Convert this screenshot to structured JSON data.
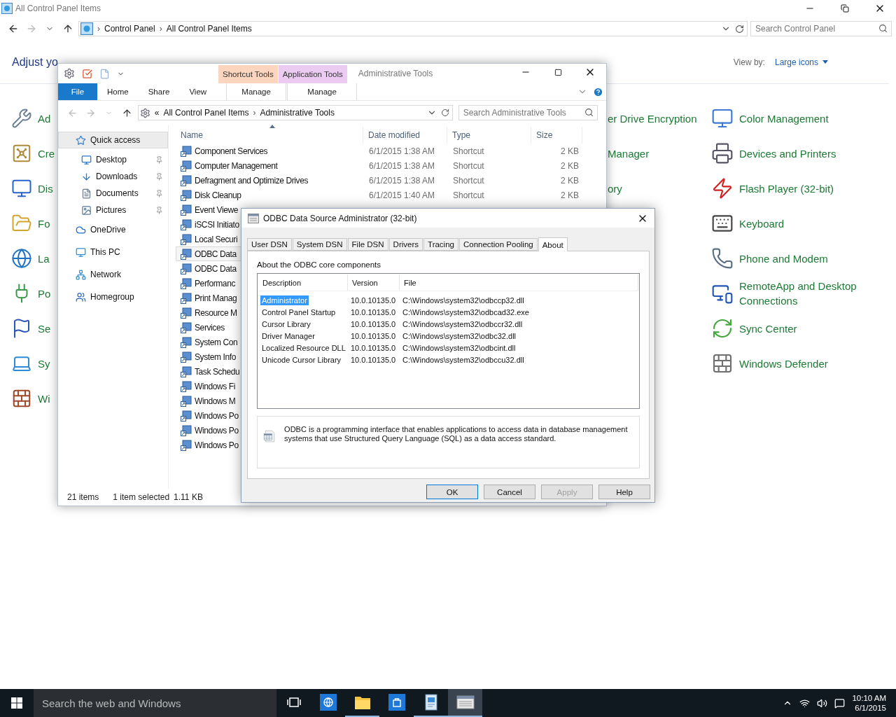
{
  "control_panel": {
    "title": "All Control Panel Items",
    "breadcrumb": [
      "Control Panel",
      "All Control Panel Items"
    ],
    "search": {
      "placeholder": "Search Control Panel"
    },
    "heading": "Adjust yo",
    "view_by_label": "View by:",
    "view_by_value": "Large icons",
    "separator": "›",
    "columns": [
      {
        "items": [
          "Ad",
          "Cre",
          "Dis",
          "Fo",
          "La",
          "Po",
          "Se",
          "Sy",
          "Wi"
        ]
      },
      {
        "items": [
          "er Drive Encryption",
          "Manager",
          "ory"
        ]
      },
      {
        "items": [
          "Color Management",
          "Devices and Printers",
          "Flash Player (32-bit)",
          "Keyboard",
          "Phone and Modem",
          "RemoteApp and Desktop Connections",
          "Sync Center",
          "Windows Defender"
        ]
      }
    ]
  },
  "explorer": {
    "context_tabs": [
      {
        "label": "Shortcut Tools",
        "tab": "Manage",
        "color": "#fbd5bd"
      },
      {
        "label": "Application Tools",
        "tab": "Manage",
        "color": "#eccbf3"
      }
    ],
    "title": "Administrative Tools",
    "ribbon_tabs": [
      {
        "label": "File",
        "kind": "file"
      },
      {
        "label": "Home",
        "kind": "tab"
      },
      {
        "label": "Share",
        "kind": "tab"
      },
      {
        "label": "View",
        "kind": "tab"
      }
    ],
    "address": {
      "overflow_mark": "«",
      "separator": "›",
      "crumbs": [
        "All Control Panel Items",
        "Administrative Tools"
      ]
    },
    "search": {
      "placeholder": "Search Administrative Tools"
    },
    "nav": [
      {
        "label": "Quick access",
        "selected": true,
        "children": [
          {
            "label": "Desktop",
            "pinned": true,
            "selected": false
          },
          {
            "label": "Downloads",
            "pinned": true,
            "selected": false
          },
          {
            "label": "Documents",
            "pinned": true,
            "selected": false
          },
          {
            "label": "Pictures",
            "pinned": true,
            "selected": false
          }
        ]
      },
      {
        "label": "OneDrive",
        "selected": false
      },
      {
        "label": "This PC",
        "selected": false
      },
      {
        "label": "Network",
        "selected": false
      },
      {
        "label": "Homegroup",
        "selected": false
      }
    ],
    "columns": [
      "Name",
      "Date modified",
      "Type",
      "Size"
    ],
    "files": [
      {
        "name": "Component Services",
        "date": "6/1/2015 1:38 AM",
        "type": "Shortcut",
        "size": "2 KB",
        "selected": false
      },
      {
        "name": "Computer Management",
        "date": "6/1/2015 1:38 AM",
        "type": "Shortcut",
        "size": "2 KB",
        "selected": false
      },
      {
        "name": "Defragment and Optimize Drives",
        "date": "6/1/2015 1:38 AM",
        "type": "Shortcut",
        "size": "2 KB",
        "selected": false
      },
      {
        "name": "Disk Cleanup",
        "date": "6/1/2015 1:40 AM",
        "type": "Shortcut",
        "size": "2 KB",
        "selected": false
      },
      {
        "name": "Event Viewe",
        "selected": false
      },
      {
        "name": "iSCSI Initiato",
        "selected": false
      },
      {
        "name": "Local Securi",
        "selected": false
      },
      {
        "name": "ODBC Data",
        "selected": true
      },
      {
        "name": "ODBC Data",
        "selected": false
      },
      {
        "name": "Performanc",
        "selected": false
      },
      {
        "name": "Print Manag",
        "selected": false
      },
      {
        "name": "Resource M",
        "selected": false
      },
      {
        "name": "Services",
        "selected": false
      },
      {
        "name": "System Con",
        "selected": false
      },
      {
        "name": "System Info",
        "selected": false
      },
      {
        "name": "Task Schedu",
        "selected": false
      },
      {
        "name": "Windows Fi",
        "selected": false
      },
      {
        "name": "Windows M",
        "selected": false
      },
      {
        "name": "Windows Po",
        "selected": false
      },
      {
        "name": "Windows Po",
        "selected": false
      },
      {
        "name": "Windows Po",
        "selected": false
      }
    ],
    "status": {
      "count": "21 items",
      "selection": "1 item selected",
      "size": "1.11 KB"
    }
  },
  "dialog": {
    "title": "ODBC Data Source Administrator (32-bit)",
    "tabs": [
      {
        "label": "User DSN",
        "selected": false
      },
      {
        "label": "System DSN",
        "selected": false
      },
      {
        "label": "File DSN",
        "selected": false
      },
      {
        "label": "Drivers",
        "selected": false
      },
      {
        "label": "Tracing",
        "selected": false
      },
      {
        "label": "Connection Pooling",
        "selected": false
      },
      {
        "label": "About",
        "selected": true
      }
    ],
    "section_label": "About the ODBC core components",
    "columns": [
      "Description",
      "Version",
      "File"
    ],
    "rows": [
      {
        "description": "Administrator",
        "version": "10.0.10135.0",
        "file": "C:\\Windows\\system32\\odbccp32.dll",
        "selected": true
      },
      {
        "description": "Control Panel Startup",
        "version": "10.0.10135.0",
        "file": "C:\\Windows\\system32\\odbcad32.exe",
        "selected": false
      },
      {
        "description": "Cursor Library",
        "version": "10.0.10135.0",
        "file": "C:\\Windows\\system32\\odbccr32.dll",
        "selected": false
      },
      {
        "description": "Driver Manager",
        "version": "10.0.10135.0",
        "file": "C:\\Windows\\system32\\odbc32.dll",
        "selected": false
      },
      {
        "description": "Localized Resource DLL",
        "version": "10.0.10135.0",
        "file": "C:\\Windows\\system32\\odbcint.dll",
        "selected": false
      },
      {
        "description": "Unicode Cursor Library",
        "version": "10.0.10135.0",
        "file": "C:\\Windows\\system32\\odbccu32.dll",
        "selected": false
      }
    ],
    "info": "ODBC is a programming interface that enables applications to access data in database management systems that use Structured Query Language (SQL) as a data access standard.",
    "buttons": [
      {
        "label": "OK",
        "default": true,
        "disabled": false
      },
      {
        "label": "Cancel",
        "default": false,
        "disabled": false
      },
      {
        "label": "Apply",
        "default": false,
        "disabled": true
      },
      {
        "label": "Help",
        "default": false,
        "disabled": false
      }
    ]
  },
  "taskbar": {
    "search": {
      "placeholder": "Search the web and Windows"
    },
    "apps": [
      {
        "running": false,
        "active": false
      },
      {
        "running": false,
        "active": false
      },
      {
        "running": true,
        "active": false
      },
      {
        "running": false,
        "active": false
      },
      {
        "running": true,
        "active": false
      },
      {
        "running": true,
        "active": true
      }
    ],
    "time": "10:10 AM",
    "date": "6/1/2015"
  }
}
